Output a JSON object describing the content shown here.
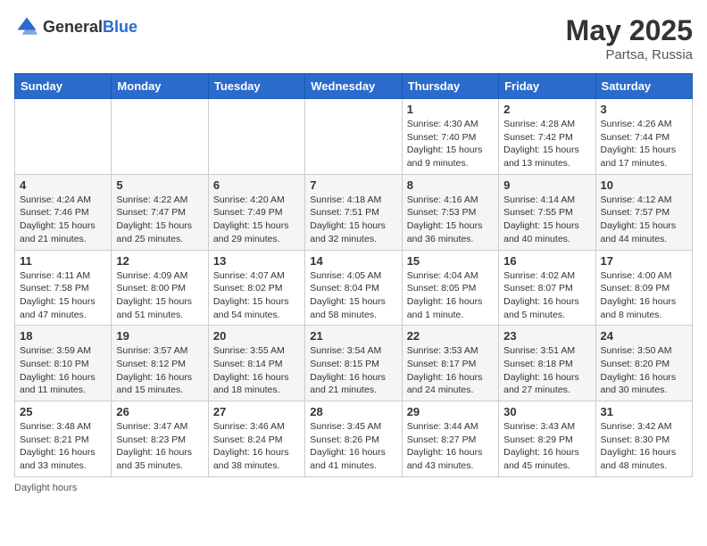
{
  "logo": {
    "general": "General",
    "blue": "Blue"
  },
  "header": {
    "month_year": "May 2025",
    "location": "Partsa, Russia"
  },
  "days_of_week": [
    "Sunday",
    "Monday",
    "Tuesday",
    "Wednesday",
    "Thursday",
    "Friday",
    "Saturday"
  ],
  "weeks": [
    [
      {
        "day": "",
        "info": ""
      },
      {
        "day": "",
        "info": ""
      },
      {
        "day": "",
        "info": ""
      },
      {
        "day": "",
        "info": ""
      },
      {
        "day": "1",
        "info": "Sunrise: 4:30 AM\nSunset: 7:40 PM\nDaylight: 15 hours and 9 minutes."
      },
      {
        "day": "2",
        "info": "Sunrise: 4:28 AM\nSunset: 7:42 PM\nDaylight: 15 hours and 13 minutes."
      },
      {
        "day": "3",
        "info": "Sunrise: 4:26 AM\nSunset: 7:44 PM\nDaylight: 15 hours and 17 minutes."
      }
    ],
    [
      {
        "day": "4",
        "info": "Sunrise: 4:24 AM\nSunset: 7:46 PM\nDaylight: 15 hours and 21 minutes."
      },
      {
        "day": "5",
        "info": "Sunrise: 4:22 AM\nSunset: 7:47 PM\nDaylight: 15 hours and 25 minutes."
      },
      {
        "day": "6",
        "info": "Sunrise: 4:20 AM\nSunset: 7:49 PM\nDaylight: 15 hours and 29 minutes."
      },
      {
        "day": "7",
        "info": "Sunrise: 4:18 AM\nSunset: 7:51 PM\nDaylight: 15 hours and 32 minutes."
      },
      {
        "day": "8",
        "info": "Sunrise: 4:16 AM\nSunset: 7:53 PM\nDaylight: 15 hours and 36 minutes."
      },
      {
        "day": "9",
        "info": "Sunrise: 4:14 AM\nSunset: 7:55 PM\nDaylight: 15 hours and 40 minutes."
      },
      {
        "day": "10",
        "info": "Sunrise: 4:12 AM\nSunset: 7:57 PM\nDaylight: 15 hours and 44 minutes."
      }
    ],
    [
      {
        "day": "11",
        "info": "Sunrise: 4:11 AM\nSunset: 7:58 PM\nDaylight: 15 hours and 47 minutes."
      },
      {
        "day": "12",
        "info": "Sunrise: 4:09 AM\nSunset: 8:00 PM\nDaylight: 15 hours and 51 minutes."
      },
      {
        "day": "13",
        "info": "Sunrise: 4:07 AM\nSunset: 8:02 PM\nDaylight: 15 hours and 54 minutes."
      },
      {
        "day": "14",
        "info": "Sunrise: 4:05 AM\nSunset: 8:04 PM\nDaylight: 15 hours and 58 minutes."
      },
      {
        "day": "15",
        "info": "Sunrise: 4:04 AM\nSunset: 8:05 PM\nDaylight: 16 hours and 1 minute."
      },
      {
        "day": "16",
        "info": "Sunrise: 4:02 AM\nSunset: 8:07 PM\nDaylight: 16 hours and 5 minutes."
      },
      {
        "day": "17",
        "info": "Sunrise: 4:00 AM\nSunset: 8:09 PM\nDaylight: 16 hours and 8 minutes."
      }
    ],
    [
      {
        "day": "18",
        "info": "Sunrise: 3:59 AM\nSunset: 8:10 PM\nDaylight: 16 hours and 11 minutes."
      },
      {
        "day": "19",
        "info": "Sunrise: 3:57 AM\nSunset: 8:12 PM\nDaylight: 16 hours and 15 minutes."
      },
      {
        "day": "20",
        "info": "Sunrise: 3:55 AM\nSunset: 8:14 PM\nDaylight: 16 hours and 18 minutes."
      },
      {
        "day": "21",
        "info": "Sunrise: 3:54 AM\nSunset: 8:15 PM\nDaylight: 16 hours and 21 minutes."
      },
      {
        "day": "22",
        "info": "Sunrise: 3:53 AM\nSunset: 8:17 PM\nDaylight: 16 hours and 24 minutes."
      },
      {
        "day": "23",
        "info": "Sunrise: 3:51 AM\nSunset: 8:18 PM\nDaylight: 16 hours and 27 minutes."
      },
      {
        "day": "24",
        "info": "Sunrise: 3:50 AM\nSunset: 8:20 PM\nDaylight: 16 hours and 30 minutes."
      }
    ],
    [
      {
        "day": "25",
        "info": "Sunrise: 3:48 AM\nSunset: 8:21 PM\nDaylight: 16 hours and 33 minutes."
      },
      {
        "day": "26",
        "info": "Sunrise: 3:47 AM\nSunset: 8:23 PM\nDaylight: 16 hours and 35 minutes."
      },
      {
        "day": "27",
        "info": "Sunrise: 3:46 AM\nSunset: 8:24 PM\nDaylight: 16 hours and 38 minutes."
      },
      {
        "day": "28",
        "info": "Sunrise: 3:45 AM\nSunset: 8:26 PM\nDaylight: 16 hours and 41 minutes."
      },
      {
        "day": "29",
        "info": "Sunrise: 3:44 AM\nSunset: 8:27 PM\nDaylight: 16 hours and 43 minutes."
      },
      {
        "day": "30",
        "info": "Sunrise: 3:43 AM\nSunset: 8:29 PM\nDaylight: 16 hours and 45 minutes."
      },
      {
        "day": "31",
        "info": "Sunrise: 3:42 AM\nSunset: 8:30 PM\nDaylight: 16 hours and 48 minutes."
      }
    ]
  ],
  "footer_note": "Daylight hours"
}
